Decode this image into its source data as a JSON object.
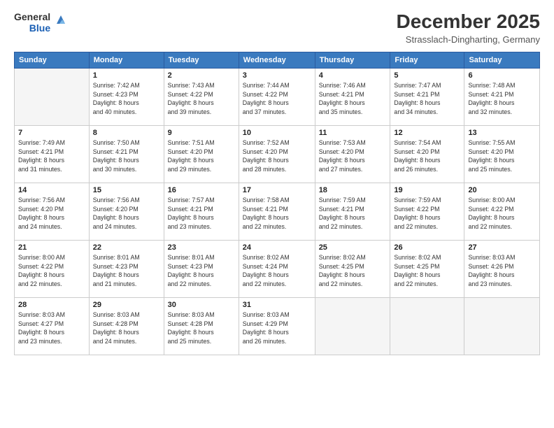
{
  "logo": {
    "text1": "General",
    "text2": "Blue"
  },
  "header": {
    "month": "December 2025",
    "location": "Strasslach-Dingharting, Germany"
  },
  "weekdays": [
    "Sunday",
    "Monday",
    "Tuesday",
    "Wednesday",
    "Thursday",
    "Friday",
    "Saturday"
  ],
  "weeks": [
    [
      {
        "day": "",
        "info": ""
      },
      {
        "day": "1",
        "info": "Sunrise: 7:42 AM\nSunset: 4:23 PM\nDaylight: 8 hours\nand 40 minutes."
      },
      {
        "day": "2",
        "info": "Sunrise: 7:43 AM\nSunset: 4:22 PM\nDaylight: 8 hours\nand 39 minutes."
      },
      {
        "day": "3",
        "info": "Sunrise: 7:44 AM\nSunset: 4:22 PM\nDaylight: 8 hours\nand 37 minutes."
      },
      {
        "day": "4",
        "info": "Sunrise: 7:46 AM\nSunset: 4:21 PM\nDaylight: 8 hours\nand 35 minutes."
      },
      {
        "day": "5",
        "info": "Sunrise: 7:47 AM\nSunset: 4:21 PM\nDaylight: 8 hours\nand 34 minutes."
      },
      {
        "day": "6",
        "info": "Sunrise: 7:48 AM\nSunset: 4:21 PM\nDaylight: 8 hours\nand 32 minutes."
      }
    ],
    [
      {
        "day": "7",
        "info": "Sunrise: 7:49 AM\nSunset: 4:21 PM\nDaylight: 8 hours\nand 31 minutes."
      },
      {
        "day": "8",
        "info": "Sunrise: 7:50 AM\nSunset: 4:21 PM\nDaylight: 8 hours\nand 30 minutes."
      },
      {
        "day": "9",
        "info": "Sunrise: 7:51 AM\nSunset: 4:20 PM\nDaylight: 8 hours\nand 29 minutes."
      },
      {
        "day": "10",
        "info": "Sunrise: 7:52 AM\nSunset: 4:20 PM\nDaylight: 8 hours\nand 28 minutes."
      },
      {
        "day": "11",
        "info": "Sunrise: 7:53 AM\nSunset: 4:20 PM\nDaylight: 8 hours\nand 27 minutes."
      },
      {
        "day": "12",
        "info": "Sunrise: 7:54 AM\nSunset: 4:20 PM\nDaylight: 8 hours\nand 26 minutes."
      },
      {
        "day": "13",
        "info": "Sunrise: 7:55 AM\nSunset: 4:20 PM\nDaylight: 8 hours\nand 25 minutes."
      }
    ],
    [
      {
        "day": "14",
        "info": "Sunrise: 7:56 AM\nSunset: 4:20 PM\nDaylight: 8 hours\nand 24 minutes."
      },
      {
        "day": "15",
        "info": "Sunrise: 7:56 AM\nSunset: 4:20 PM\nDaylight: 8 hours\nand 24 minutes."
      },
      {
        "day": "16",
        "info": "Sunrise: 7:57 AM\nSunset: 4:21 PM\nDaylight: 8 hours\nand 23 minutes."
      },
      {
        "day": "17",
        "info": "Sunrise: 7:58 AM\nSunset: 4:21 PM\nDaylight: 8 hours\nand 22 minutes."
      },
      {
        "day": "18",
        "info": "Sunrise: 7:59 AM\nSunset: 4:21 PM\nDaylight: 8 hours\nand 22 minutes."
      },
      {
        "day": "19",
        "info": "Sunrise: 7:59 AM\nSunset: 4:22 PM\nDaylight: 8 hours\nand 22 minutes."
      },
      {
        "day": "20",
        "info": "Sunrise: 8:00 AM\nSunset: 4:22 PM\nDaylight: 8 hours\nand 22 minutes."
      }
    ],
    [
      {
        "day": "21",
        "info": "Sunrise: 8:00 AM\nSunset: 4:22 PM\nDaylight: 8 hours\nand 22 minutes."
      },
      {
        "day": "22",
        "info": "Sunrise: 8:01 AM\nSunset: 4:23 PM\nDaylight: 8 hours\nand 21 minutes."
      },
      {
        "day": "23",
        "info": "Sunrise: 8:01 AM\nSunset: 4:23 PM\nDaylight: 8 hours\nand 22 minutes."
      },
      {
        "day": "24",
        "info": "Sunrise: 8:02 AM\nSunset: 4:24 PM\nDaylight: 8 hours\nand 22 minutes."
      },
      {
        "day": "25",
        "info": "Sunrise: 8:02 AM\nSunset: 4:25 PM\nDaylight: 8 hours\nand 22 minutes."
      },
      {
        "day": "26",
        "info": "Sunrise: 8:02 AM\nSunset: 4:25 PM\nDaylight: 8 hours\nand 22 minutes."
      },
      {
        "day": "27",
        "info": "Sunrise: 8:03 AM\nSunset: 4:26 PM\nDaylight: 8 hours\nand 23 minutes."
      }
    ],
    [
      {
        "day": "28",
        "info": "Sunrise: 8:03 AM\nSunset: 4:27 PM\nDaylight: 8 hours\nand 23 minutes."
      },
      {
        "day": "29",
        "info": "Sunrise: 8:03 AM\nSunset: 4:28 PM\nDaylight: 8 hours\nand 24 minutes."
      },
      {
        "day": "30",
        "info": "Sunrise: 8:03 AM\nSunset: 4:28 PM\nDaylight: 8 hours\nand 25 minutes."
      },
      {
        "day": "31",
        "info": "Sunrise: 8:03 AM\nSunset: 4:29 PM\nDaylight: 8 hours\nand 26 minutes."
      },
      {
        "day": "",
        "info": ""
      },
      {
        "day": "",
        "info": ""
      },
      {
        "day": "",
        "info": ""
      }
    ]
  ]
}
